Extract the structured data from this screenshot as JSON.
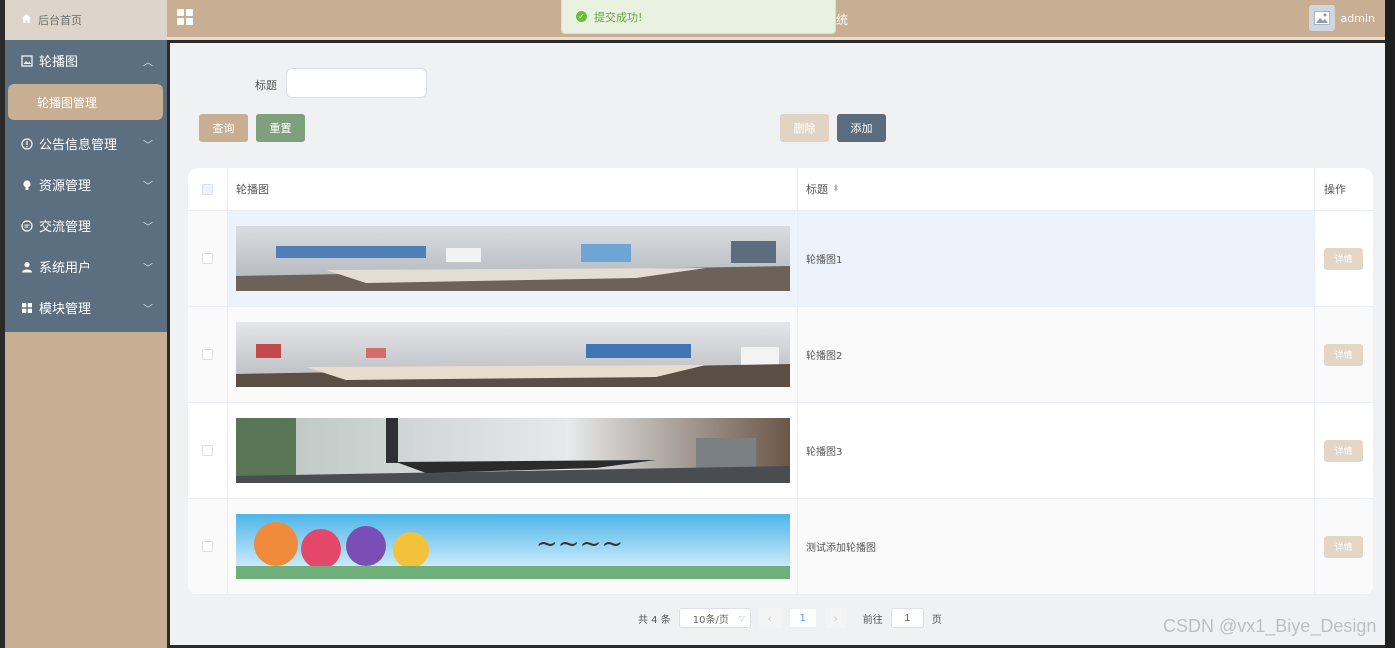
{
  "sidebar": {
    "home_label": "后台首页",
    "groups": [
      {
        "label": "轮播图",
        "icon": "image-icon",
        "expanded": true,
        "children": [
          "轮播图管理"
        ]
      },
      {
        "label": "公告信息管理",
        "icon": "info-icon"
      },
      {
        "label": "资源管理",
        "icon": "bulb-icon"
      },
      {
        "label": "交流管理",
        "icon": "chat-icon"
      },
      {
        "label": "系统用户",
        "icon": "user-icon"
      },
      {
        "label": "模块管理",
        "icon": "grid-icon"
      }
    ]
  },
  "topbar": {
    "title": "欢迎使用商铺租赁管理系统",
    "user": "admin"
  },
  "toast": {
    "message": "提交成功!"
  },
  "search": {
    "label": "标题",
    "value": "",
    "placeholder": "",
    "query_label": "查询",
    "reset_label": "重置",
    "delete_label": "删除",
    "add_label": "添加"
  },
  "table": {
    "headers": {
      "image": "轮播图",
      "title": "标题",
      "action": "操作"
    },
    "rows": [
      {
        "title": "轮播图1",
        "action": "详情"
      },
      {
        "title": "轮播图2",
        "action": "详情"
      },
      {
        "title": "轮播图3",
        "action": "详情"
      },
      {
        "title": "测试添加轮播图",
        "action": "详情"
      }
    ]
  },
  "pager": {
    "total": "共 4 条",
    "size": "10条/页",
    "current": "1",
    "goto_label": "前往",
    "goto_value": "1",
    "page_unit": "页"
  },
  "watermark": "CSDN @vx1_Biye_Design",
  "colors": {
    "accent": "#c8ae92",
    "sidebar_bg": "#5b6f80",
    "reset_green": "#7ea07d",
    "add_slate": "#5a6c7d"
  }
}
